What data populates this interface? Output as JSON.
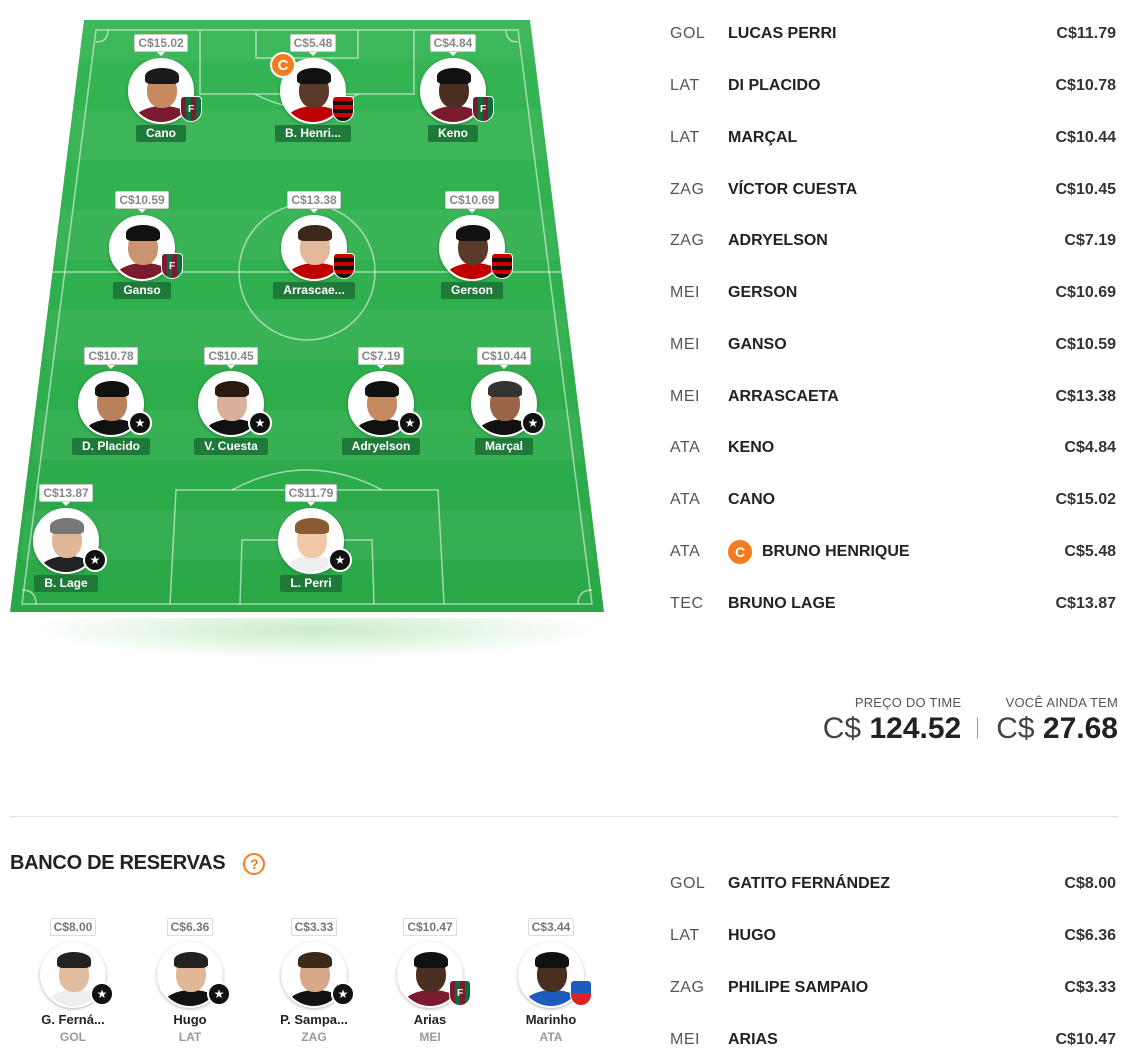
{
  "colors": {
    "field": "#2fb24f",
    "captain": "#f47b20",
    "name_tag": "#1f7a3a"
  },
  "field": {
    "captain_letter": "C",
    "players": [
      {
        "id": "cano",
        "name": "Cano",
        "price": "C$15.02",
        "club": "flu",
        "skin": "#c68a5e",
        "hair": "#1a1a1a",
        "shirt": "#7a1b2f"
      },
      {
        "id": "bhenrique",
        "name": "B. Henri...",
        "price": "C$5.48",
        "club": "fla",
        "skin": "#5a3a28",
        "hair": "#111",
        "shirt": "#c00000",
        "captain": true
      },
      {
        "id": "keno",
        "name": "Keno",
        "price": "C$4.84",
        "club": "flu",
        "skin": "#4a2e20",
        "hair": "#111",
        "shirt": "#7a1b2f"
      },
      {
        "id": "ganso",
        "name": "Ganso",
        "price": "C$10.59",
        "club": "flu",
        "skin": "#c99470",
        "hair": "#111",
        "shirt": "#7a1b2f"
      },
      {
        "id": "arrascaeta",
        "name": "Arrascae...",
        "price": "C$13.38",
        "club": "fla",
        "skin": "#e2b89a",
        "hair": "#3b2a1a",
        "shirt": "#c00000"
      },
      {
        "id": "gerson",
        "name": "Gerson",
        "price": "C$10.69",
        "club": "fla",
        "skin": "#5a3a28",
        "hair": "#111",
        "shirt": "#c00000"
      },
      {
        "id": "dplacido",
        "name": "D. Placido",
        "price": "C$10.78",
        "club": "bot",
        "skin": "#b9805c",
        "hair": "#111",
        "shirt": "#111"
      },
      {
        "id": "vcuesta",
        "name": "V. Cuesta",
        "price": "C$10.45",
        "club": "bot",
        "skin": "#dbb09a",
        "hair": "#2a1a10",
        "shirt": "#111"
      },
      {
        "id": "adryelson",
        "name": "Adryelson",
        "price": "C$7.19",
        "club": "bot",
        "skin": "#c48a62",
        "hair": "#111",
        "shirt": "#111"
      },
      {
        "id": "marcal",
        "name": "Marçal",
        "price": "C$10.44",
        "club": "bot",
        "skin": "#9a6446",
        "hair": "#333",
        "shirt": "#111"
      },
      {
        "id": "blage",
        "name": "B. Lage",
        "price": "C$13.87",
        "club": "bot",
        "skin": "#e0b898",
        "hair": "#777",
        "shirt": "#222"
      },
      {
        "id": "lperri",
        "name": "L. Perri",
        "price": "C$11.79",
        "club": "bot",
        "skin": "#f0c8a8",
        "hair": "#8a5a30",
        "shirt": "#eee"
      }
    ]
  },
  "lineup": [
    {
      "pos": "GOL",
      "name": "LUCAS PERRI",
      "price": "C$11.79"
    },
    {
      "pos": "LAT",
      "name": "DI PLACIDO",
      "price": "C$10.78"
    },
    {
      "pos": "LAT",
      "name": "MARÇAL",
      "price": "C$10.44"
    },
    {
      "pos": "ZAG",
      "name": "VÍCTOR CUESTA",
      "price": "C$10.45"
    },
    {
      "pos": "ZAG",
      "name": "ADRYELSON",
      "price": "C$7.19"
    },
    {
      "pos": "MEI",
      "name": "GERSON",
      "price": "C$10.69"
    },
    {
      "pos": "MEI",
      "name": "GANSO",
      "price": "C$10.59"
    },
    {
      "pos": "MEI",
      "name": "ARRASCAETA",
      "price": "C$13.38"
    },
    {
      "pos": "ATA",
      "name": "KENO",
      "price": "C$4.84"
    },
    {
      "pos": "ATA",
      "name": "CANO",
      "price": "C$15.02"
    },
    {
      "pos": "ATA",
      "name": "BRUNO HENRIQUE",
      "price": "C$5.48",
      "captain": true
    },
    {
      "pos": "TEC",
      "name": "BRUNO LAGE",
      "price": "C$13.87"
    }
  ],
  "budget": {
    "team_price_label": "PREÇO DO TIME",
    "team_price_currency": "C$",
    "team_price_value": "124.52",
    "remaining_label": "VOCÊ AINDA TEM",
    "remaining_currency": "C$",
    "remaining_value": "27.68"
  },
  "bench": {
    "title": "BANCO DE RESERVAS",
    "help": "?",
    "players": [
      {
        "id": "gfernandez",
        "name": "G. Ferná...",
        "pos": "GOL",
        "price": "C$8.00",
        "club": "bot",
        "skin": "#e2bc9e",
        "hair": "#222",
        "shirt": "#eee"
      },
      {
        "id": "hugo",
        "name": "Hugo",
        "pos": "LAT",
        "price": "C$6.36",
        "club": "bot",
        "skin": "#e0b898",
        "hair": "#222",
        "shirt": "#111"
      },
      {
        "id": "psampaio",
        "name": "P. Sampa...",
        "pos": "ZAG",
        "price": "C$3.33",
        "club": "bot",
        "skin": "#d8a888",
        "hair": "#3a2a1a",
        "shirt": "#111"
      },
      {
        "id": "arias",
        "name": "Arias",
        "pos": "MEI",
        "price": "C$10.47",
        "club": "flu",
        "skin": "#4a2e20",
        "hair": "#111",
        "shirt": "#7a1b2f"
      },
      {
        "id": "marinho",
        "name": "Marinho",
        "pos": "ATA",
        "price": "C$3.44",
        "club": "for",
        "skin": "#4a2e20",
        "hair": "#111",
        "shirt": "#1d5bbf"
      }
    ],
    "list": [
      {
        "pos": "GOL",
        "name": "GATITO FERNÁNDEZ",
        "price": "C$8.00"
      },
      {
        "pos": "LAT",
        "name": "HUGO",
        "price": "C$6.36"
      },
      {
        "pos": "ZAG",
        "name": "PHILIPE SAMPAIO",
        "price": "C$3.33"
      },
      {
        "pos": "MEI",
        "name": "ARIAS",
        "price": "C$10.47"
      }
    ]
  }
}
